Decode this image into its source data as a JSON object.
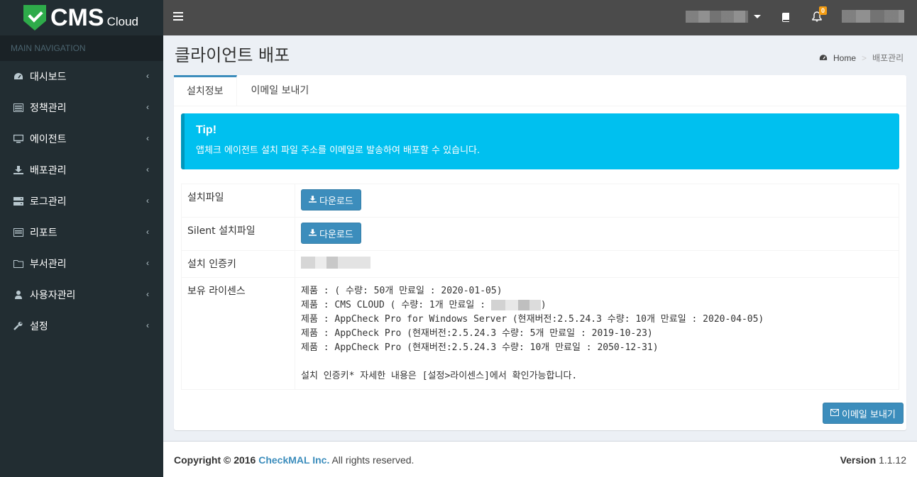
{
  "logo": {
    "brand": "CMS",
    "suffix": "Cloud"
  },
  "sidebar": {
    "header": "MAIN NAVIGATION",
    "items": [
      {
        "label": "대시보드",
        "icon": "dashboard-icon"
      },
      {
        "label": "정책관리",
        "icon": "list-icon"
      },
      {
        "label": "에이전트",
        "icon": "desktop-icon"
      },
      {
        "label": "배포관리",
        "icon": "download-icon"
      },
      {
        "label": "로그관리",
        "icon": "server-icon"
      },
      {
        "label": "리포트",
        "icon": "report-icon"
      },
      {
        "label": "부서관리",
        "icon": "folder-icon"
      },
      {
        "label": "사용자관리",
        "icon": "user-icon"
      },
      {
        "label": "설정",
        "icon": "wrench-icon"
      }
    ],
    "chevron": "‹"
  },
  "topbar": {
    "notification_count": "0"
  },
  "page": {
    "title": "클라이언트 배포",
    "breadcrumb": {
      "home": "Home",
      "current": "배포관리"
    }
  },
  "tabs": {
    "install": "설치정보",
    "email": "이메일 보내기"
  },
  "callout": {
    "title": "Tip!",
    "text": "앱체크 에이전트 설치 파일 주소를 이메일로 발송하여 배포할 수 있습니다."
  },
  "info": {
    "install_file_label": "설치파일",
    "silent_file_label": "Silent 설치파일",
    "download_label": "다운로드",
    "auth_key_label": "설치 인증키",
    "license_label": "보유 라이센스",
    "licenses": {
      "line1": "제품 : ( 수량: 50개 만료일 : 2020-01-05)",
      "line2_prefix": "제품 : CMS CLOUD ( 수량: 1개 만료일 : ",
      "line2_suffix": ")",
      "line3": "제품 : AppCheck Pro for Windows Server (현재버전:2.5.24.3 수량: 10개 만료일 : 2020-04-05)",
      "line4": "제품 : AppCheck Pro (현재버전:2.5.24.3 수량: 5개 만료일 : 2019-10-23)",
      "line5": "제품 : AppCheck Pro (현재버전:2.5.24.3 수량: 10개 만료일 : 2050-12-31)",
      "note": "설치 인증키* 자세한 내용은 [설정>라이센스]에서 확인가능합니다."
    }
  },
  "email_button": "이메일 보내기",
  "footer": {
    "copyright_prefix": "Copyright © 2016",
    "brand": "CheckMAL Inc.",
    "rights": "All rights reserved.",
    "version_label": "Version",
    "version": "1.1.12"
  },
  "colors": {
    "primary": "#3c8dbc",
    "callout": "#00c0ef",
    "sidebar": "#222d32",
    "topbar": "#4b4b4b",
    "badge": "#f39c12"
  }
}
